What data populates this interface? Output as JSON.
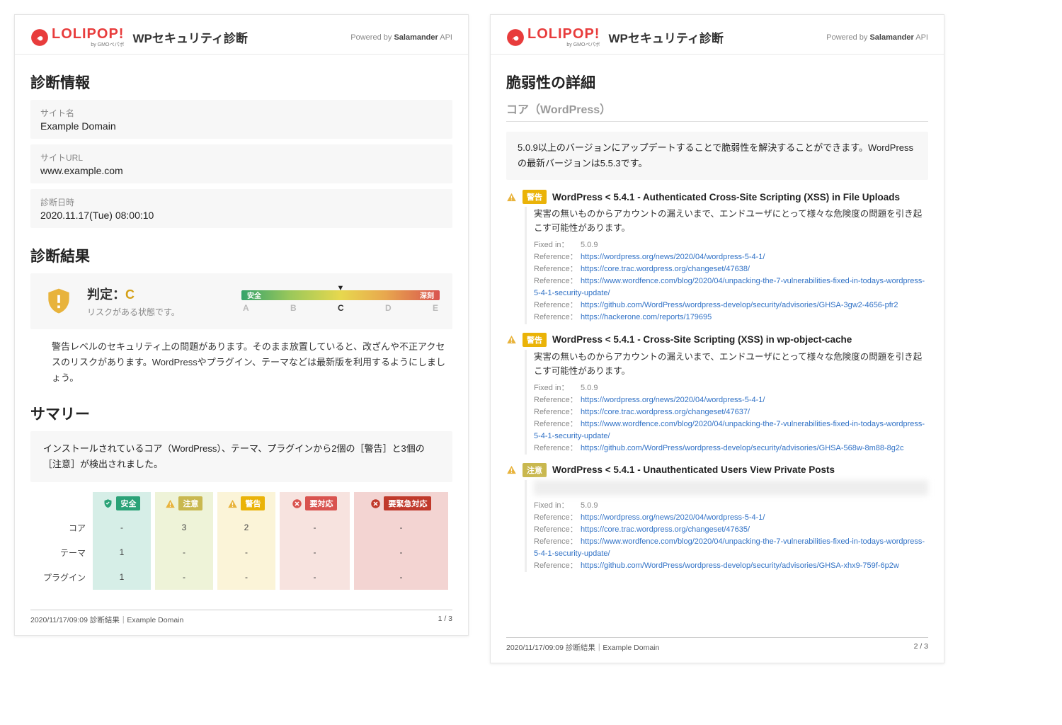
{
  "brand": {
    "name": "LOLIPOP!",
    "byline": "by GMOペパボ"
  },
  "app_title": "WPセキュリティ診断",
  "powered_prefix": "Powered by ",
  "powered_name": "Salamander",
  "powered_suffix": " API",
  "s_info_title": "診断情報",
  "info": {
    "site_name_lbl": "サイト名",
    "site_name": "Example Domain",
    "site_url_lbl": "サイトURL",
    "site_url": "www.example.com",
    "scan_date_lbl": "診断日時",
    "scan_date": "2020.11.17(Tue) 08:00:10"
  },
  "s_result_title": "診断結果",
  "verdict": {
    "label": "判定：",
    "grade": "C",
    "desc": "リスクがある状態です。",
    "safe_word": "安全",
    "severe_word": "深刻",
    "letters": [
      "A",
      "B",
      "C",
      "D",
      "E"
    ],
    "active": 2,
    "note": "警告レベルのセキュリティ上の問題があります。そのまま放置していると、改ざんや不正アクセスのリスクがあります。WordPressやプラグイン、テーマなどは最新版を利用するようにしましょう。"
  },
  "s_summary_title": "サマリー",
  "summary_note": "インストールされているコア（WordPress）、テーマ、プラグインから2個の［警告］と3個の［注意］が検出されました。",
  "sev": {
    "safe": "安全",
    "info": "注意",
    "warn": "警告",
    "act": "要対応",
    "crit": "要緊急対応"
  },
  "rows": [
    {
      "name": "コア",
      "safe": "-",
      "info": "3",
      "warn": "2",
      "act": "-",
      "crit": "-"
    },
    {
      "name": "テーマ",
      "safe": "1",
      "info": "-",
      "warn": "-",
      "act": "-",
      "crit": "-"
    },
    {
      "name": "プラグイン",
      "safe": "1",
      "info": "-",
      "warn": "-",
      "act": "-",
      "crit": "-"
    }
  ],
  "footer": {
    "text": "2020/11/17/09:09 診断結果｜Example Domain",
    "p1": "1 / 3",
    "p2": "2 / 3"
  },
  "p2": {
    "title": "脆弱性の詳細",
    "subsection": "コア（WordPress）",
    "hint": "5.0.9以上のバージョンにアップデートすることで脆弱性を解決することができます。WordPressの最新バージョンは5.5.3です。",
    "fixed_lbl": "Fixed in：",
    "ref_lbl": "Reference：",
    "items": [
      {
        "sev": "warn",
        "sev_lbl": "警告",
        "title": "WordPress < 5.4.1 - Authenticated Cross-Site Scripting (XSS) in File Uploads",
        "desc": "実害の無いものからアカウントの漏えいまで、エンドユーザにとって様々な危険度の問題を引き起こす可能性があります。",
        "fixed": "5.0.9",
        "refs": [
          "https://wordpress.org/news/2020/04/wordpress-5-4-1/",
          "https://core.trac.wordpress.org/changeset/47638/",
          "https://www.wordfence.com/blog/2020/04/unpacking-the-7-vulnerabilities-fixed-in-todays-wordpress-5-4-1-security-update/",
          "https://github.com/WordPress/wordpress-develop/security/advisories/GHSA-3gw2-4656-pfr2",
          "https://hackerone.com/reports/179695"
        ]
      },
      {
        "sev": "warn",
        "sev_lbl": "警告",
        "title": "WordPress < 5.4.1 - Cross-Site Scripting (XSS) in wp-object-cache",
        "desc": "実害の無いものからアカウントの漏えいまで、エンドユーザにとって様々な危険度の問題を引き起こす可能性があります。",
        "fixed": "5.0.9",
        "refs": [
          "https://wordpress.org/news/2020/04/wordpress-5-4-1/",
          "https://core.trac.wordpress.org/changeset/47637/",
          "https://www.wordfence.com/blog/2020/04/unpacking-the-7-vulnerabilities-fixed-in-todays-wordpress-5-4-1-security-update/",
          "https://github.com/WordPress/wordpress-develop/security/advisories/GHSA-568w-8m88-8g2c"
        ]
      },
      {
        "sev": "info",
        "sev_lbl": "注意",
        "title": "WordPress < 5.4.1 - Unauthenticated Users View Private Posts",
        "desc": "",
        "blur": true,
        "fixed": "5.0.9",
        "refs": [
          "https://wordpress.org/news/2020/04/wordpress-5-4-1/",
          "https://core.trac.wordpress.org/changeset/47635/",
          "https://www.wordfence.com/blog/2020/04/unpacking-the-7-vulnerabilities-fixed-in-todays-wordpress-5-4-1-security-update/",
          "https://github.com/WordPress/wordpress-develop/security/advisories/GHSA-xhx9-759f-6p2w"
        ]
      }
    ]
  }
}
